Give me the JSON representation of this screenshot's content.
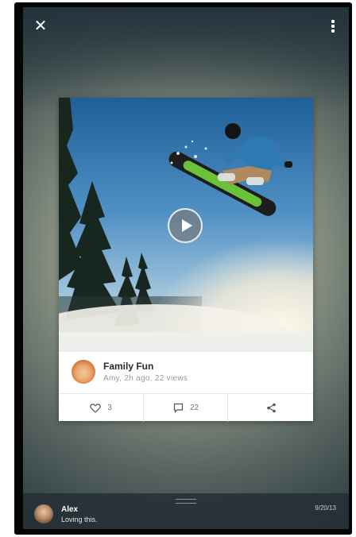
{
  "toolbar": {
    "close_icon": "close-icon",
    "more_icon": "more-vertical-icon"
  },
  "post": {
    "media": "snowboarder jumping over snow against blue sky",
    "play_icon": "play-icon",
    "title": "Family Fun",
    "meta": "Amy, 2h ago, 22 views",
    "likes": "3",
    "comments": "22",
    "share_icon": "share-icon"
  },
  "comment": {
    "author": "Alex",
    "text": "Loving this.",
    "date": "9/20/13"
  },
  "colors": {
    "card_bg": "#ffffff",
    "footer_bg": "#243036",
    "title": "#2a2a2a",
    "meta": "#9a9a9a"
  }
}
